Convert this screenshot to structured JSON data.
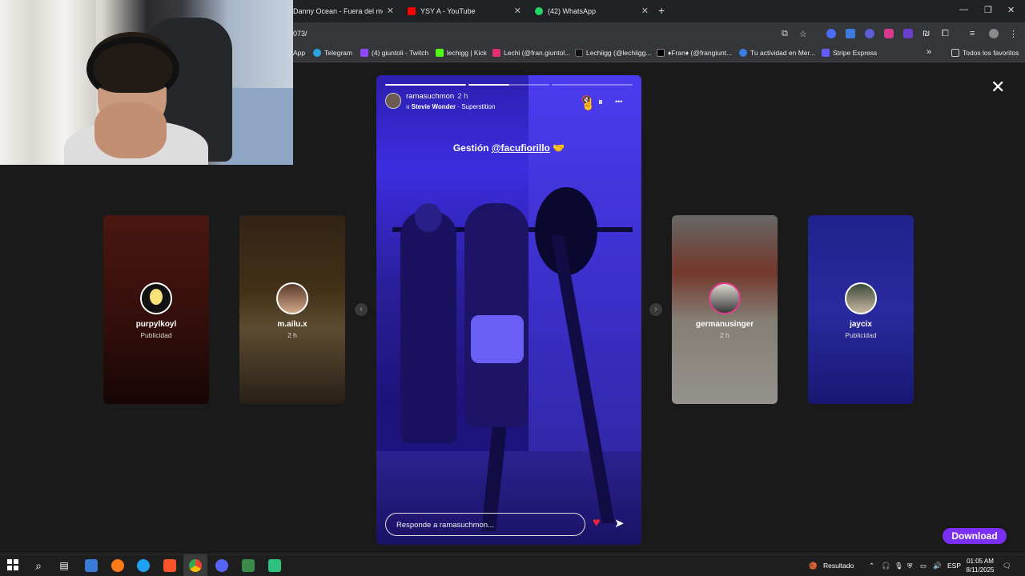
{
  "tabs": [
    {
      "label": "Danny Ocean - Fuera del merca",
      "close": "✕"
    },
    {
      "label": "YSY A - YouTube",
      "close": "✕"
    },
    {
      "label": "(42) WhatsApp",
      "close": "✕"
    }
  ],
  "new_tab_symbol": "+",
  "window_controls": {
    "minimize": "—",
    "restore": "❐",
    "close": "✕"
  },
  "address": "073/",
  "bookmarks": [
    "App",
    "Telegram",
    "(4) giuntoli - Twitch",
    "lechigg | Kick",
    "Lechi (@fran.giuntol...",
    "Lechiigg (@lechiigg...",
    "♦Fran♦ (@frangiunt...",
    "Tu actividad en Mer...",
    "Stripe Express"
  ],
  "bookmarks_more": "»",
  "bookmarks_folder": "Todos los favoritos",
  "viewer": {
    "close_symbol": "✕",
    "prev_arrow": "‹",
    "next_arrow": "›",
    "side_stories": [
      {
        "name": "purpylkoyl",
        "sub": "Publicidad",
        "avatar": "lightbulb-icon",
        "color": "#8a2a22"
      },
      {
        "name": "m.ailu.x",
        "sub": "2 h",
        "avatar": "person-photo",
        "color": "#7a5a2a"
      },
      {
        "name": "germanusinger",
        "sub": "2 h",
        "avatar": "person-photo",
        "color": "#7a4a3a"
      },
      {
        "name": "jaycix",
        "sub": "Publicidad",
        "avatar": "person-photo",
        "color": "#2b2bb8"
      }
    ],
    "story": {
      "username": "ramasuchmon",
      "time": "2 h",
      "song_artist": "Stevie Wonder",
      "song_title": "Superstition",
      "song_separator": " · ",
      "caption_prefix": "Gestión ",
      "caption_mention": "@facufiorillo",
      "caption_emoji": "🤝",
      "reply_placeholder": "Responde a ramasuchmon...",
      "pause_symbol": "⏸",
      "more_symbol": "•••",
      "mute_symbol": "🔇",
      "heart_symbol": "♥",
      "send_symbol": "➤",
      "progress_segments": 3,
      "progress_current_index": 1,
      "progress_current_fraction": 0.5
    }
  },
  "download_label": "Download",
  "taskbar": {
    "search_symbol": "⌕",
    "result_label": "Resultado",
    "language": "ESP",
    "time": "01:05 AM",
    "date": "8/11/2025"
  },
  "colors": {
    "accent_purple": "#7b2ff2",
    "heart_red": "#f0243a",
    "story_blue": "#3c2de0"
  }
}
